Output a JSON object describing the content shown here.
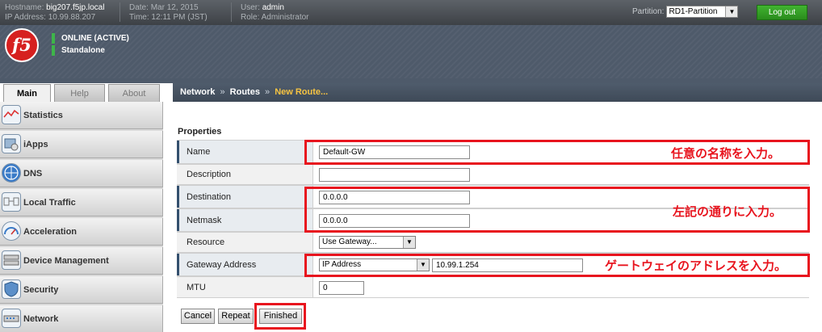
{
  "topbar": {
    "hostname_label": "Hostname:",
    "hostname": "big207.f5jp.local",
    "ip_label": "IP Address:",
    "ip": "10.99.88.207",
    "date_label": "Date:",
    "date": "Mar 12, 2015",
    "time_label": "Time:",
    "time": "12:11 PM (JST)",
    "user_label": "User:",
    "user": "admin",
    "role_label": "Role:",
    "role": "Administrator",
    "partition_label": "Partition:",
    "partition_value": "RD1-Partition",
    "logout_label": "Log out"
  },
  "header": {
    "logo_text": "f5",
    "status_line1": "ONLINE (ACTIVE)",
    "status_line2": "Standalone"
  },
  "tabs": [
    {
      "label": "Main"
    },
    {
      "label": "Help"
    },
    {
      "label": "About"
    }
  ],
  "sidebar": {
    "items": [
      {
        "label": "Statistics"
      },
      {
        "label": "iApps"
      },
      {
        "label": "DNS"
      },
      {
        "label": "Local Traffic"
      },
      {
        "label": "Acceleration"
      },
      {
        "label": "Device Management"
      },
      {
        "label": "Security"
      },
      {
        "label": "Network"
      }
    ]
  },
  "breadcrumb": {
    "items": [
      "Network",
      "Routes",
      "New Route..."
    ],
    "separator": "»"
  },
  "form": {
    "section_title": "Properties",
    "name_label": "Name",
    "name_value": "Default-GW",
    "description_label": "Description",
    "description_value": "",
    "destination_label": "Destination",
    "destination_value": "0.0.0.0",
    "netmask_label": "Netmask",
    "netmask_value": "0.0.0.0",
    "resource_label": "Resource",
    "resource_value": "Use Gateway...",
    "gateway_label": "Gateway Address",
    "gateway_type": "IP Address",
    "gateway_value": "10.99.1.254",
    "mtu_label": "MTU",
    "mtu_value": "0"
  },
  "buttons": {
    "cancel": "Cancel",
    "repeat": "Repeat",
    "finished": "Finished"
  },
  "annotations": {
    "name_note": "任意の名称を入力。",
    "dest_note": "左記の通りに入力。",
    "gateway_note": "ゲートウェイのアドレスを入力。",
    "color": "#e8141e"
  },
  "colors": {
    "breadcrumb_current": "#f6c342",
    "logout_green": "#2a8c1c",
    "logo_red": "#d6201f"
  }
}
